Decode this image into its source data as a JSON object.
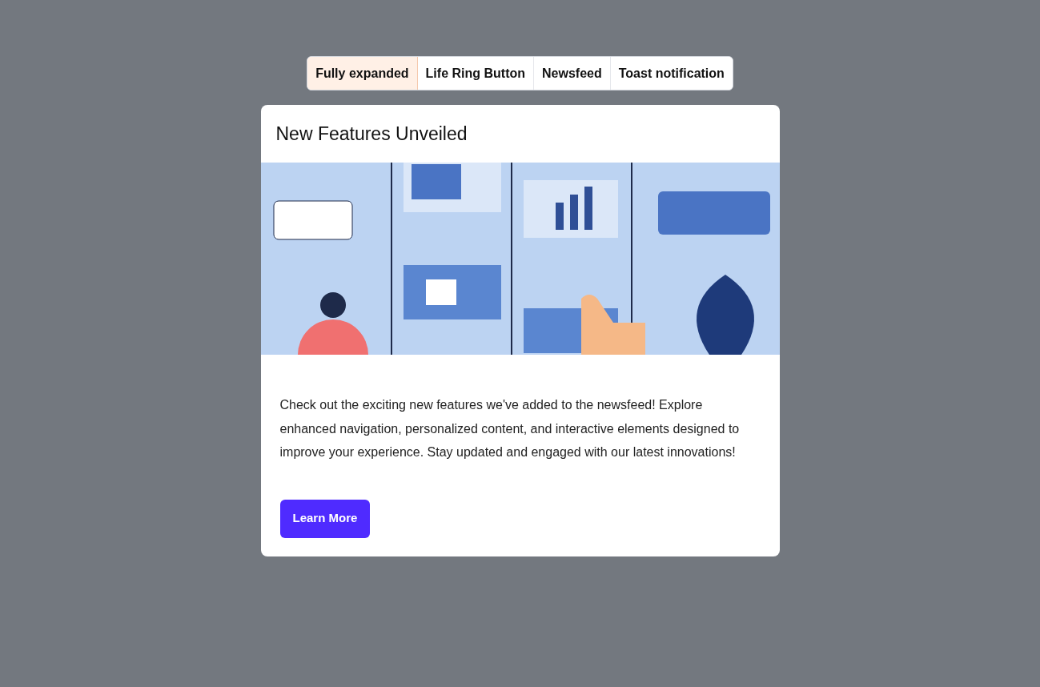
{
  "tabs": [
    {
      "label": "Fully expanded",
      "selected": true
    },
    {
      "label": "Life Ring Button",
      "selected": false
    },
    {
      "label": "Newsfeed",
      "selected": false
    },
    {
      "label": "Toast notification",
      "selected": false
    }
  ],
  "modal": {
    "title": "New Features Unveiled",
    "body": "Check out the exciting new features we've added to the newsfeed! Explore enhanced navigation, personalized content, and interactive elements designed to improve your experience. Stay updated and engaged with our latest innovations!",
    "button": "Learn More"
  }
}
